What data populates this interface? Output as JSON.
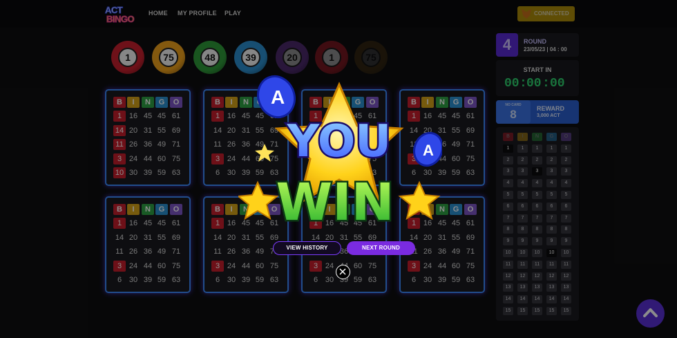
{
  "nav": {
    "logo_top": "ACT",
    "logo_bottom": "BINGO",
    "links": [
      "HOME",
      "MY PROFILE",
      "PLAY"
    ],
    "connect_label": "CONNECTED"
  },
  "called_balls": [
    {
      "number": "1",
      "color": "#c8202e"
    },
    {
      "number": "75",
      "color": "#f0a21c"
    },
    {
      "number": "48",
      "color": "#2f9b3a"
    },
    {
      "number": "39",
      "color": "#2b8fcf"
    },
    {
      "number": "20",
      "color": "#7d3fb6"
    },
    {
      "number": "1",
      "color": "#c8202e"
    },
    {
      "number": "75",
      "color": "#f0a21c"
    }
  ],
  "bingo_header": [
    {
      "letter": "B",
      "color": "#c8202e"
    },
    {
      "letter": "I",
      "color": "#d8a418"
    },
    {
      "letter": "N",
      "color": "#2fa344"
    },
    {
      "letter": "G",
      "color": "#2b93d4"
    },
    {
      "letter": "O",
      "color": "#7f56c9"
    }
  ],
  "cards": [
    {
      "rows": [
        [
          "1",
          "16",
          "45",
          "45",
          "61"
        ],
        [
          "14",
          "20",
          "31",
          "55",
          "69"
        ],
        [
          "11",
          "26",
          "36",
          "49",
          "71"
        ],
        [
          "3",
          "24",
          "44",
          "60",
          "75"
        ],
        [
          "10",
          "30",
          "39",
          "59",
          "63"
        ]
      ],
      "marked": [
        "0-0",
        "1-0",
        "2-0",
        "3-0",
        "4-0"
      ]
    },
    {
      "rows": [
        [
          "1",
          "16",
          "45",
          "45",
          "61"
        ],
        [
          "14",
          "20",
          "31",
          "55",
          "69"
        ],
        [
          "11",
          "26",
          "36",
          "49",
          "71"
        ],
        [
          "3",
          "24",
          "44",
          "60",
          "75"
        ],
        [
          "6",
          "30",
          "39",
          "59",
          "63"
        ]
      ],
      "marked": [
        "0-0",
        "3-0"
      ]
    },
    {
      "rows": [
        [
          "1",
          "16",
          "45",
          "45",
          "61"
        ],
        [
          "14",
          "20",
          "31",
          "55",
          "69"
        ],
        [
          "11",
          "26",
          "36",
          "49",
          "71"
        ],
        [
          "3",
          "24",
          "44",
          "60",
          "75"
        ],
        [
          "6",
          "30",
          "39",
          "59",
          "63"
        ]
      ],
      "marked": [
        "0-0",
        "3-0"
      ]
    },
    {
      "rows": [
        [
          "1",
          "16",
          "45",
          "45",
          "61"
        ],
        [
          "14",
          "20",
          "31",
          "55",
          "69"
        ],
        [
          "11",
          "26",
          "36",
          "49",
          "71"
        ],
        [
          "3",
          "24",
          "44",
          "60",
          "75"
        ],
        [
          "6",
          "30",
          "39",
          "59",
          "63"
        ]
      ],
      "marked": [
        "0-0",
        "3-0"
      ]
    },
    {
      "rows": [
        [
          "1",
          "16",
          "45",
          "45",
          "61"
        ],
        [
          "14",
          "20",
          "31",
          "55",
          "69"
        ],
        [
          "11",
          "26",
          "36",
          "49",
          "71"
        ],
        [
          "3",
          "24",
          "44",
          "60",
          "75"
        ],
        [
          "6",
          "30",
          "39",
          "59",
          "63"
        ]
      ],
      "marked": [
        "0-0",
        "3-0"
      ]
    },
    {
      "rows": [
        [
          "1",
          "16",
          "45",
          "45",
          "61"
        ],
        [
          "14",
          "20",
          "31",
          "55",
          "69"
        ],
        [
          "11",
          "26",
          "36",
          "49",
          "71"
        ],
        [
          "3",
          "24",
          "44",
          "60",
          "75"
        ],
        [
          "6",
          "30",
          "39",
          "59",
          "63"
        ]
      ],
      "marked": [
        "0-0",
        "3-0"
      ]
    },
    {
      "rows": [
        [
          "1",
          "16",
          "45",
          "45",
          "61"
        ],
        [
          "14",
          "20",
          "31",
          "55",
          "69"
        ],
        [
          "11",
          "26",
          "36",
          "49",
          "71"
        ],
        [
          "3",
          "24",
          "44",
          "60",
          "75"
        ],
        [
          "6",
          "30",
          "39",
          "59",
          "63"
        ]
      ],
      "marked": [
        "0-0",
        "3-0"
      ]
    },
    {
      "rows": [
        [
          "1",
          "16",
          "45",
          "45",
          "61"
        ],
        [
          "14",
          "20",
          "31",
          "55",
          "69"
        ],
        [
          "11",
          "26",
          "36",
          "49",
          "71"
        ],
        [
          "3",
          "24",
          "44",
          "60",
          "75"
        ],
        [
          "6",
          "30",
          "39",
          "59",
          "63"
        ]
      ],
      "marked": [
        "0-0",
        "3-0"
      ]
    }
  ],
  "round": {
    "number": "4",
    "label": "ROUND",
    "datetime": "23/05/23 | 04 : 00"
  },
  "start": {
    "label": "START IN",
    "hh": "00",
    "mm": "00",
    "ss": "00"
  },
  "reward": {
    "card_label": "NO CARD",
    "card_count": "8",
    "label": "REWARD",
    "amount": "3,000 ACT"
  },
  "board": {
    "header": [
      "B",
      "I",
      "N",
      "G",
      "O"
    ],
    "rows": 15,
    "called": [
      [
        1,
        0
      ],
      [
        10,
        3
      ],
      [
        3,
        2
      ]
    ]
  },
  "modal": {
    "you": "YOU",
    "win": "WIN",
    "view_history": "VIEW HISTORY",
    "next_round": "NEXT ROUND"
  }
}
